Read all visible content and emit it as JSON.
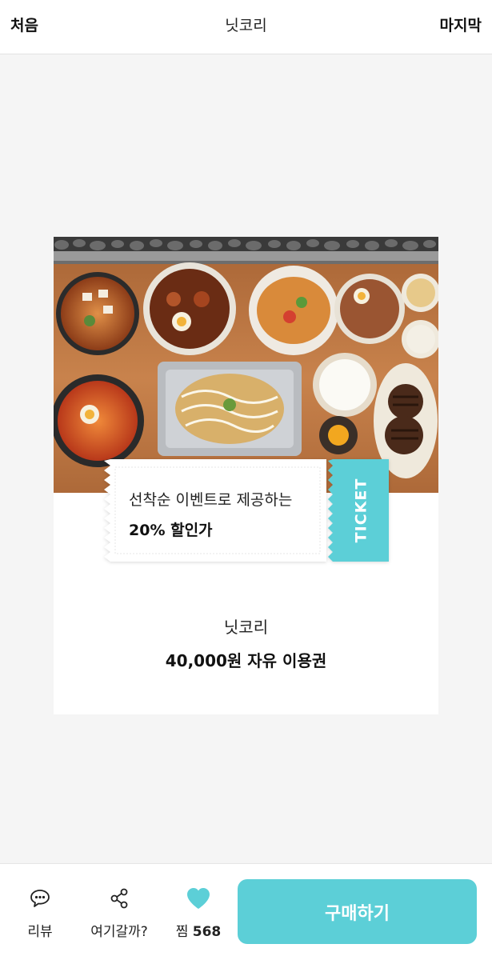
{
  "header": {
    "left_label": "처음",
    "title": "닛코리",
    "right_label": "마지막"
  },
  "card": {
    "ticket": {
      "line1": "선착순 이벤트로 제공하는",
      "line2": "20% 할인가",
      "stub_label": "TICKET"
    },
    "store_name": "닛코리",
    "product_name": "40,000원 자유 이용권"
  },
  "bottom_bar": {
    "review_label": "리뷰",
    "share_label": "여기갈까?",
    "like_label": "찜",
    "like_count": "568",
    "buy_label": "구매하기"
  },
  "colors": {
    "accent": "#5ccfd7",
    "background": "#f5f5f5"
  },
  "icons": {
    "review": "speech-bubble-icon",
    "share": "share-icon",
    "like": "heart-icon"
  }
}
